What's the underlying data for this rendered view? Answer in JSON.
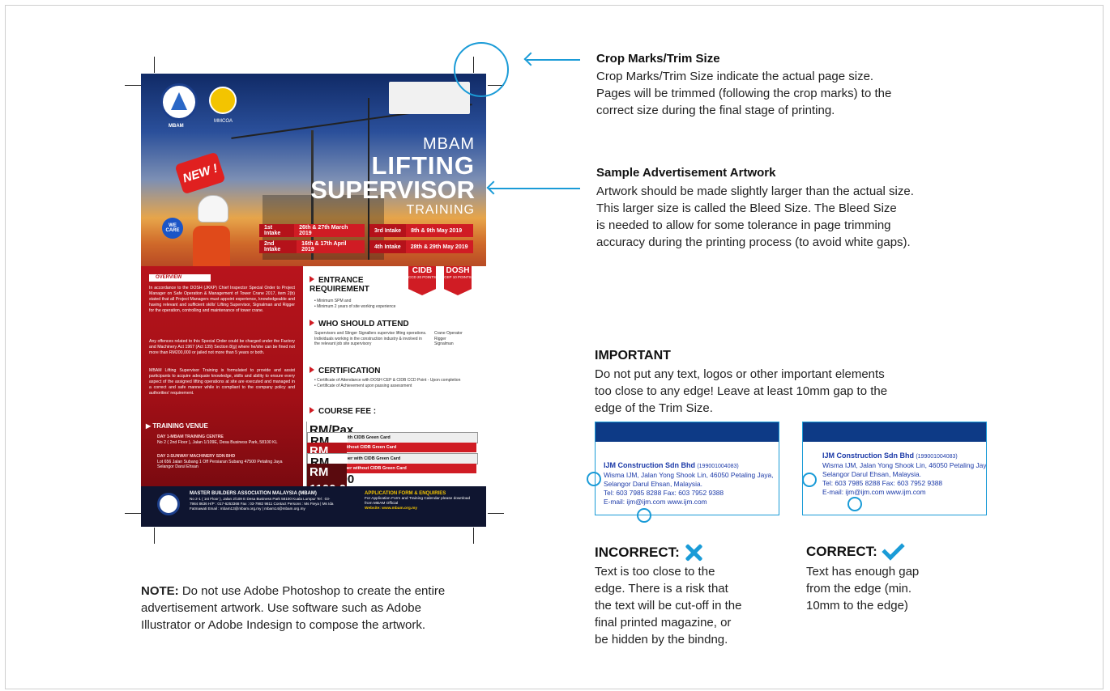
{
  "poster": {
    "org_logo_text": "MBAM",
    "partner_logo_text": "MMCOA",
    "title_line1": "MBAM",
    "title_line2": "LIFTING",
    "title_line3": "SUPERVISOR",
    "title_line4": "TRAINING",
    "new_badge": "NEW !",
    "we_care": "WE CARE",
    "intakes": [
      {
        "label": "1st Intake",
        "dates": "26th & 27th March 2019"
      },
      {
        "label": "2nd Intake",
        "dates": "16th & 17th April 2019"
      },
      {
        "label": "3rd Intake",
        "dates": "8th & 9th May 2019"
      },
      {
        "label": "4th Intake",
        "dates": "28th & 29th May 2019"
      }
    ],
    "overview_tag": "OVERVIEW",
    "overview_p1": "In accordance to the DOSH (JKKP) Chief Inspector Special Order to Project Manager on Safe Operation & Management of Tower Crane 2017, item 2(b) stated that all Project Managers must appoint experience, knowledgeable and having relevant and sufficient skills' Lifting Supervisor, Signalman and Rigger for the operation, controlling and maintenance of tower crane.",
    "overview_p2": "Any offences related to this Special Order could be charged under the Factory and Machinery Act 1967 (Act 139) Section 8(g) where he/she can be fined not more than RM200,000 or jailed not more than 5 years or both.",
    "overview_p3": "MBAM Lifting Supervisor Training is formulated to provide and assist participants to acquire adequate knowledge, skills and ability to ensure every aspect of the assigned lifting operations at site are executed and managed in a correct and safe manner while in compliant to the company policy and authorities' requirement.",
    "venue_head": "TRAINING VENUE",
    "venue1_title": "DAY 1-MBAM TRAINING CENTRE",
    "venue1_addr": "No 2 ( 2nd Floor ), Jalan 1/109E, Desa Business Park, 58100 KL",
    "venue2_title": "DAY 2-SUNWAY MACHINERY SDN BHD",
    "venue2_addr": "Lot 656 Jalan Subang 1 Off Persiaran Subang 47500 Petaling Jaya Selangor Darul Ehsan",
    "badge1_big": "CIDB",
    "badge1_small": "CCD 20 POINTS",
    "badge2_big": "DOSH",
    "badge2_small": "CEP 10 POINTS",
    "entrance_h": "ENTRANCE REQUIREMENT",
    "entrance_t": "• Minimum SPM and\n• Minimum 2 years of site working experience",
    "who_h": "WHO SHOULD ATTEND",
    "who_left": "Supervisors and Slinger Signallers supervise lifting operations.\nIndividuals working in the construction industry & involved in the relevant job site supervisory",
    "who_right": "Crane Operator\nRigger\nSignalman",
    "cert_h": "CERTIFICATION",
    "cert_t": "• Certificate of Attendance with DOSH CEP & CIDB CCD Point - Upon completion\n• Certificate of Achievement upon passing assessment",
    "fee_h": "COURSE FEE :",
    "fee_col": "RM/Pax",
    "fees": [
      {
        "name": "MBAM Member with CIDB Green Card",
        "price": "RM 850.00"
      },
      {
        "name": "MBAM Member without CIDB Green Card",
        "price": "RM 950.00"
      },
      {
        "name": "Non-MBAM Member with CIDB Green Card",
        "price": "RM 1000.00"
      },
      {
        "name": "Non-MBAM Member without CIDB Green Card",
        "price": "RM 1100.00"
      }
    ],
    "footer_org": "MASTER BUILDERS ASSOCIATION MALAYSIA (MBAM)",
    "footer_addr": "No 2-1 ( 1st Floor ), Jalan 2/109 E Desa Business Park 58100 Kuala Lumpur Tel : 03-7984 8636 H/P : 017-6253368 Fax : 03-7982 9811 Contact Persons : Ms Fieya | Ms Ida Fatmawati Email : mbam13@mbam.org.my | mbam14@mbam.org.my",
    "footer_right_h": "APPLICATION FORM & ENQUIRIES",
    "footer_right_t": "For Application Form and Training Calendar please download from MBAM Official",
    "footer_right_web": "Website: www.mbam.org.my"
  },
  "annotations": {
    "crop_title": "Crop Marks/Trim Size",
    "crop_lines": [
      "Crop Marks/Trim Size indicate the actual page size.",
      "Pages will be trimmed (following the crop marks) to the",
      "correct size during the final stage of printing."
    ],
    "sample_title": "Sample Advertisement  Artwork",
    "sample_lines": [
      "Artwork should be made slightly larger than the actual size.",
      "This larger size is called the Bleed Size. The Bleed Size",
      "is needed to allow for some tolerance in page trimming",
      "accuracy during the printing process (to avoid white gaps)."
    ],
    "important_title": "IMPORTANT",
    "important_lines": [
      "Do not put any text, logos or other important elements",
      "too close to any edge! Leave at least 10mm gap to the",
      "edge of the Trim Size."
    ],
    "note_label": "NOTE:",
    "note_lines": [
      " Do not use Adobe Photoshop to create the entire",
      "advertisement artwork. Use software such as Adobe",
      "Illustrator or Adobe Indesign to compose the artwork."
    ]
  },
  "cards": {
    "company": "IJM Construction Sdn Bhd",
    "reg": "(199001004083)",
    "addr1": "Wisma IJM, Jalan Yong Shook Lin, 46050 Petaling Jaya,",
    "addr2": "Selangor Darul Ehsan, Malaysia.",
    "tel": "Tel: 603 7985 8288     Fax: 603 7952 9388",
    "email": "E-mail: ijm@ijm.com       www.ijm.com"
  },
  "incorrect": {
    "label": "INCORRECT:",
    "icon": "cross-icon",
    "lines": [
      "Text is  too close to the",
      "edge. There is a risk that",
      "the text will be cut-off in the",
      "final printed magazine, or",
      "be hidden by the bindng."
    ]
  },
  "correct": {
    "label": "CORRECT:",
    "icon": "check-icon",
    "lines": [
      "Text has enough gap",
      "from the edge (min.",
      "10mm to the edge)"
    ]
  },
  "colors": {
    "accent": "#1a9bd7",
    "poster_red": "#d01c24",
    "card_band": "#0d3a86",
    "card_text": "#1c3aa8"
  }
}
